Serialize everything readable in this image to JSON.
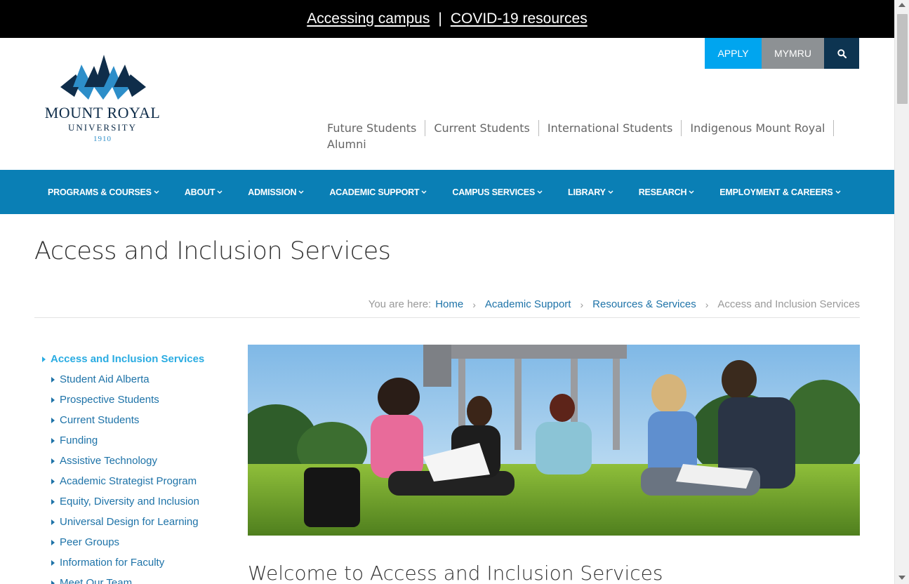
{
  "alert_bar": {
    "link1": "Accessing campus",
    "separator": "|",
    "link2": "COVID-19 resources"
  },
  "logo": {
    "line1": "MOUNT ROYAL",
    "line2": "UNIVERSITY",
    "line3": "1910",
    "colors": {
      "navy": "#0f2d4a",
      "blue": "#2d8ec9"
    }
  },
  "utility": {
    "apply": "APPLY",
    "mymru": "MYMRU",
    "search_icon": "search-icon",
    "colors": {
      "apply": "#00a5ef",
      "mymru": "#8d9194",
      "search": "#0d3451"
    }
  },
  "audience_nav": [
    "Future Students",
    "Current Students",
    "International Students",
    "Indigenous Mount Royal",
    "Alumni"
  ],
  "main_nav": [
    "PROGRAMS & COURSES",
    "ABOUT",
    "ADMISSION",
    "ACADEMIC SUPPORT",
    "CAMPUS SERVICES",
    "LIBRARY",
    "RESEARCH",
    "EMPLOYMENT & CAREERS"
  ],
  "page_title": "Access and Inclusion Services",
  "breadcrumb": {
    "label": "You are here:",
    "items": [
      "Home",
      "Academic Support",
      "Resources & Services"
    ],
    "current": "Access and Inclusion Services"
  },
  "sidebar": {
    "active": "Access and Inclusion Services",
    "items": [
      "Student Aid Alberta",
      "Prospective Students",
      "Current Students",
      "Funding",
      "Assistive Technology",
      "Academic Strategist Program",
      "Equity, Diversity and Inclusion",
      "Universal Design for Learning",
      "Peer Groups",
      "Information for Faculty",
      "Meet Our Team"
    ]
  },
  "welcome_heading": "Welcome to Access and Inclusion Services",
  "colors": {
    "nav_blue": "#0a7fb5",
    "link_blue": "#1e73a8",
    "active_blue": "#2aace2"
  }
}
